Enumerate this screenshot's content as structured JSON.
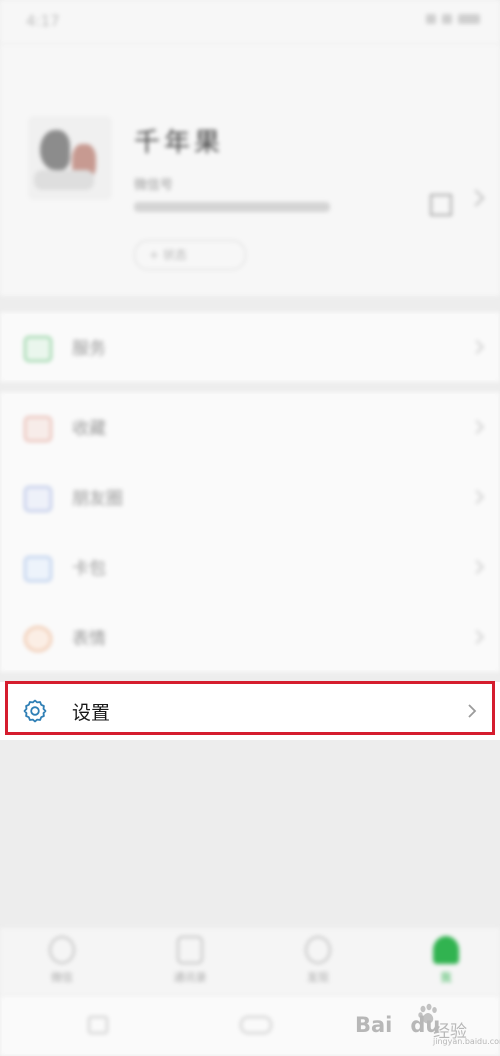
{
  "status_bar": {
    "time": "4:17"
  },
  "profile": {
    "nickname": "千年果",
    "wechat_id_label": "微信号",
    "status_label": "+ 状态"
  },
  "menu": {
    "pay_label": "服务",
    "favorites_label": "收藏",
    "moments_label": "朋友圈",
    "cards_label": "卡包",
    "emoji_label": "表情",
    "settings_label": "设置"
  },
  "tabbar": {
    "tabs": [
      "微信",
      "通讯录",
      "发现",
      "我"
    ]
  },
  "watermark": {
    "brand": "Bai",
    "brand_suffix": "du",
    "jingyan": "经验",
    "url": "jingyan.baidu.com"
  },
  "colors": {
    "highlight": "#d51d2e",
    "accent_green": "#31b350",
    "gear_blue": "#2f7fb5"
  }
}
